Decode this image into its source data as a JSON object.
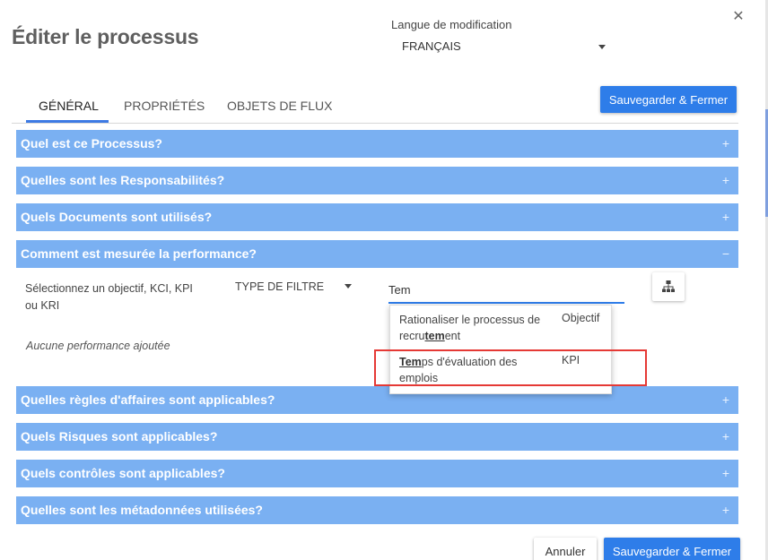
{
  "dialog": {
    "title": "Éditer le processus",
    "close_glyph": "✕"
  },
  "language": {
    "label": "Langue de modification",
    "value": "FRANÇAIS"
  },
  "tabs": [
    {
      "label": "GÉNÉRAL",
      "active": true
    },
    {
      "label": "PROPRIÉTÉS",
      "active": false
    },
    {
      "label": "OBJETS DE FLUX",
      "active": false
    }
  ],
  "buttons": {
    "save_close": "Sauvegarder & Fermer",
    "cancel": "Annuler"
  },
  "sections": [
    {
      "title": "Quel est ce Processus?",
      "toggle": "+"
    },
    {
      "title": "Quelles sont les Responsabilités?",
      "toggle": "+"
    },
    {
      "title": "Quels Documents sont utilisés?",
      "toggle": "+"
    },
    {
      "title": "Comment est mesurée la performance?",
      "toggle": "−"
    },
    {
      "title": "Quelles règles d'affaires sont applicables?",
      "toggle": "+"
    },
    {
      "title": "Quels Risques sont applicables?",
      "toggle": "+"
    },
    {
      "title": "Quels contrôles sont applicables?",
      "toggle": "+"
    },
    {
      "title": "Quelles sont les métadonnées utilisées?",
      "toggle": "+"
    }
  ],
  "performance": {
    "select_label": "Sélectionnez un objectif, KCI, KPI ou KRI",
    "filter_label": "TYPE DE FILTRE",
    "search_value": "Tem",
    "empty_note": "Aucune performance ajoutée",
    "suggestions": [
      {
        "name_before": "Rationaliser le processus de recru",
        "name_match": "tem",
        "name_after": "ent",
        "type": "Objectif"
      },
      {
        "name_before": "",
        "name_match": "Tem",
        "name_after": "ps d'évaluation des emplois",
        "type": "KPI"
      }
    ]
  },
  "colors": {
    "section_bg": "#7ab0f2",
    "primary": "#2e7de9",
    "highlight_box": "#e53935"
  },
  "icons": [
    "close-icon",
    "caret-down-icon",
    "hierarchy-icon"
  ]
}
